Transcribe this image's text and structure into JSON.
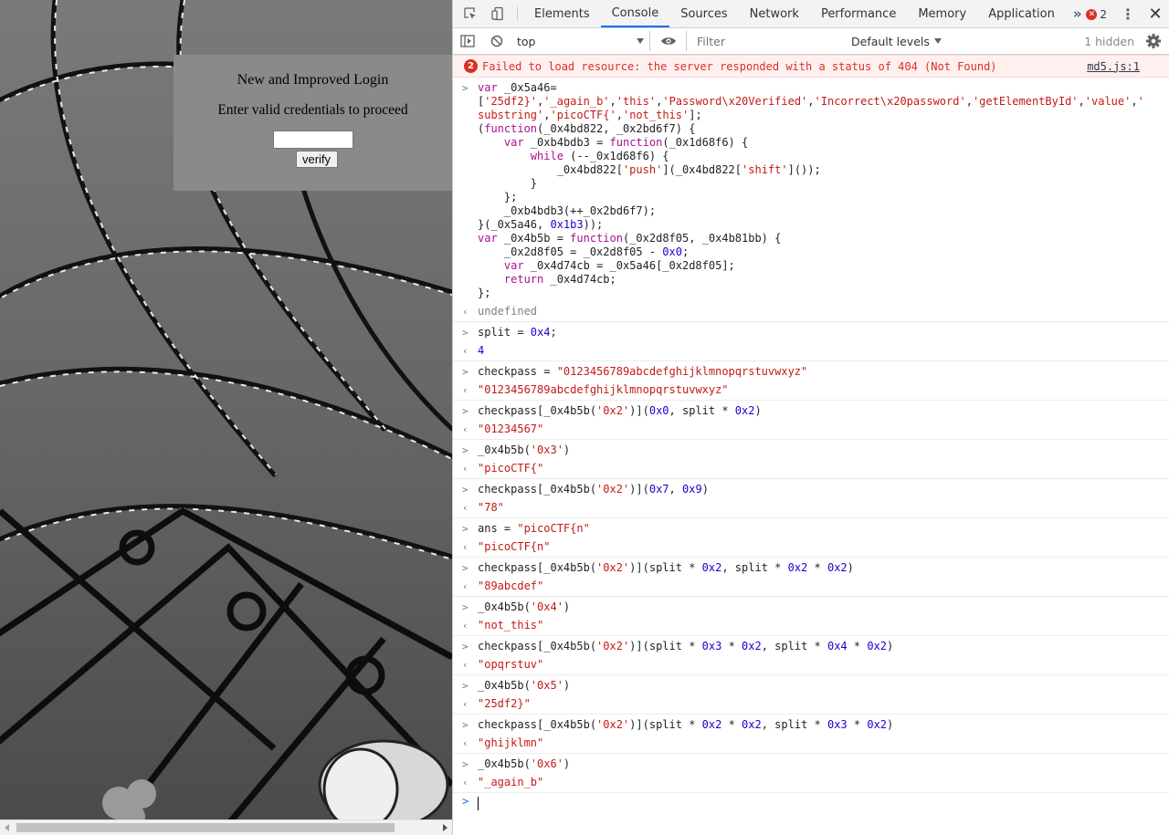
{
  "page": {
    "login_title": "New and Improved Login",
    "login_subtitle": "Enter valid credentials to proceed",
    "password_value": "",
    "verify_label": "verify"
  },
  "devtools": {
    "tabs": [
      "Elements",
      "Console",
      "Sources",
      "Network",
      "Performance",
      "Memory",
      "Application"
    ],
    "active_tab": "Console",
    "more_tabs_glyph": "»",
    "error_count": "2",
    "close_glyph": "✕",
    "kebab_glyph": "⋮",
    "toolbar": {
      "context": "top",
      "filter_placeholder": "Filter",
      "levels": "Default levels",
      "hidden": "1 hidden"
    },
    "error_message": {
      "badge": "2",
      "text": "Failed to load resource: the server responded with a status of 404 (Not Found)",
      "source": "md5.js:1"
    },
    "icons": [
      "inspect-element-icon",
      "device-toolbar-icon",
      "sidebar-toggle-icon",
      "clear-console-icon",
      "live-expression-eye-icon",
      "settings-gear-icon"
    ]
  },
  "console": [
    {
      "kind": "input",
      "text": "var _0x5a46=\n['25df2}','_again_b','this','Password\\x20Verified','Incorrect\\x20password','getElementById','value','\nsubstring','picoCTF{','not_this'];\n(function(_0x4bd822, _0x2bd6f7) {\n    var _0xb4bdb3 = function(_0x1d68f6) {\n        while (--_0x1d68f6) {\n            _0x4bd822['push'](_0x4bd822['shift']());\n        }\n    };\n    _0xb4bdb3(++_0x2bd6f7);\n}(_0x5a46, 0x1b3));\nvar _0x4b5b = function(_0x2d8f05, _0x4b81bb) {\n    _0x2d8f05 = _0x2d8f05 - 0x0;\n    var _0x4d74cb = _0x5a46[_0x2d8f05];\n    return _0x4d74cb;\n};"
    },
    {
      "kind": "result",
      "type": "undefined",
      "text": "undefined"
    },
    {
      "kind": "input",
      "text": "split = 0x4;"
    },
    {
      "kind": "result",
      "type": "number",
      "text": "4"
    },
    {
      "kind": "input",
      "text": "checkpass = \"0123456789abcdefghijklmnopqrstuvwxyz\""
    },
    {
      "kind": "result",
      "type": "string",
      "text": "\"0123456789abcdefghijklmnopqrstuvwxyz\""
    },
    {
      "kind": "input",
      "text": "checkpass[_0x4b5b('0x2')](0x0, split * 0x2)"
    },
    {
      "kind": "result",
      "type": "string",
      "text": "\"01234567\""
    },
    {
      "kind": "input",
      "text": "_0x4b5b('0x3')"
    },
    {
      "kind": "result",
      "type": "string",
      "text": "\"picoCTF{\""
    },
    {
      "kind": "input",
      "text": "checkpass[_0x4b5b('0x2')](0x7, 0x9)"
    },
    {
      "kind": "result",
      "type": "string",
      "text": "\"78\""
    },
    {
      "kind": "input",
      "text": "ans = \"picoCTF{n\""
    },
    {
      "kind": "result",
      "type": "string",
      "text": "\"picoCTF{n\""
    },
    {
      "kind": "input",
      "text": "checkpass[_0x4b5b('0x2')](split * 0x2, split * 0x2 * 0x2)"
    },
    {
      "kind": "result",
      "type": "string",
      "text": "\"89abcdef\""
    },
    {
      "kind": "input",
      "text": "_0x4b5b('0x4')"
    },
    {
      "kind": "result",
      "type": "string",
      "text": "\"not_this\""
    },
    {
      "kind": "input",
      "text": "checkpass[_0x4b5b('0x2')](split * 0x3 * 0x2, split * 0x4 * 0x2)"
    },
    {
      "kind": "result",
      "type": "string",
      "text": "\"opqrstuv\""
    },
    {
      "kind": "input",
      "text": "_0x4b5b('0x5')"
    },
    {
      "kind": "result",
      "type": "string",
      "text": "\"25df2}\""
    },
    {
      "kind": "input",
      "text": "checkpass[_0x4b5b('0x2')](split * 0x2 * 0x2, split * 0x3 * 0x2)"
    },
    {
      "kind": "result",
      "type": "string",
      "text": "\"ghijklmn\""
    },
    {
      "kind": "input",
      "text": "_0x4b5b('0x6')"
    },
    {
      "kind": "result",
      "type": "string",
      "text": "\"_again_b\""
    }
  ],
  "colors": {
    "accent": "#1a73e8",
    "error": "#d93025",
    "keyword": "#aa0d91",
    "string": "#c41a16",
    "number": "#1c00cf"
  }
}
